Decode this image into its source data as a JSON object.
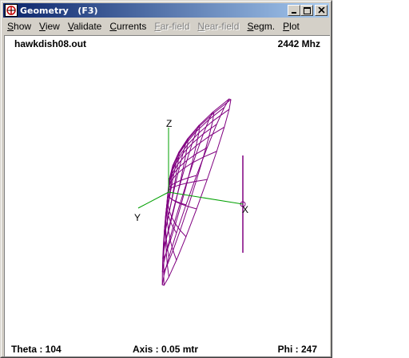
{
  "window": {
    "title": "Geometry   (F3)",
    "buttons": [
      "minimize-icon",
      "maximize-icon",
      "close-icon"
    ]
  },
  "menu": {
    "items": [
      {
        "label": "Show",
        "accel": "S",
        "rest": "how",
        "enabled": true
      },
      {
        "label": "View",
        "accel": "V",
        "rest": "iew",
        "enabled": true
      },
      {
        "label": "Validate",
        "accel": "V",
        "rest": "alidate",
        "enabled": true
      },
      {
        "label": "Currents",
        "accel": "C",
        "rest": "urrents",
        "enabled": true
      },
      {
        "label": "Far-field",
        "accel": "F",
        "rest": "ar-field",
        "enabled": false
      },
      {
        "label": "Near-field",
        "accel": "N",
        "rest": "ear-field",
        "enabled": false
      },
      {
        "label": "Segm.",
        "accel": "S",
        "rest": "egm.",
        "enabled": true
      },
      {
        "label": "Plot",
        "accel": "P",
        "rest": "lot",
        "enabled": true
      }
    ]
  },
  "geometry": {
    "filename": "hawkdish08.out",
    "frequency": "2442 Mhz",
    "theta": "Theta : 104",
    "axis": "Axis : 0.05 mtr",
    "phi": "Phi : 247",
    "axis_labels": {
      "x": "X",
      "y": "Y",
      "z": "Z"
    },
    "colors": {
      "mesh": "#800080",
      "axis": "#00a000",
      "text": "#000000"
    }
  }
}
